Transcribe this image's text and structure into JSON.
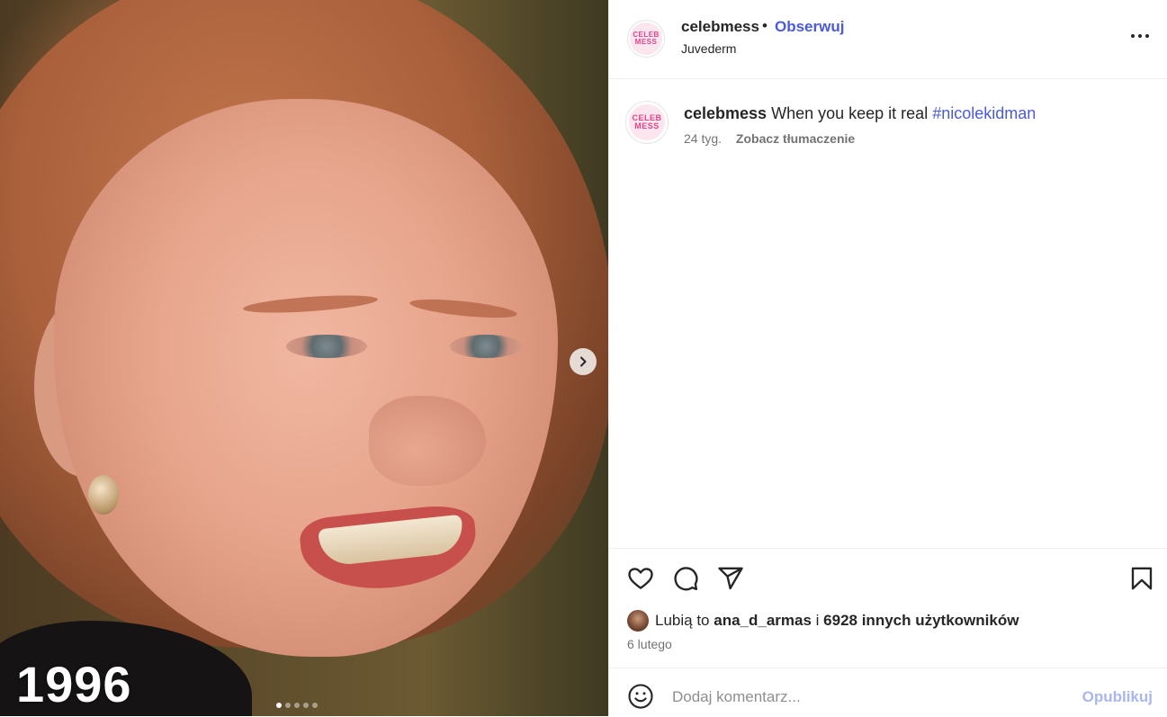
{
  "media": {
    "year_label": "1996",
    "carousel_dots": 5,
    "active_dot": 1
  },
  "header": {
    "username": "celebmess",
    "separator": "•",
    "follow_label": "Obserwuj",
    "location": "Juvederm",
    "avatar_text_top": "CELEB",
    "avatar_text_bottom": "MESS"
  },
  "caption": {
    "username": "celebmess",
    "text": "When you keep it real",
    "hashtag": "#nicolekidman",
    "age": "24 tyg.",
    "translate_label": "Zobacz tłumaczenie"
  },
  "likes": {
    "prefix": "Lubią to",
    "user": "ana_d_armas",
    "connector": "i",
    "others": "6928 innych użytkowników"
  },
  "date": "6 lutego",
  "comment": {
    "placeholder": "Dodaj komentarz...",
    "post_label": "Opublikuj"
  },
  "colors": {
    "link": "#4a5adb",
    "post_disabled": "#a9b6f0",
    "muted": "#737373"
  },
  "icons": [
    "chevron-right-icon",
    "more-icon",
    "heart-icon",
    "comment-icon",
    "share-icon",
    "bookmark-icon",
    "emoji-icon"
  ]
}
